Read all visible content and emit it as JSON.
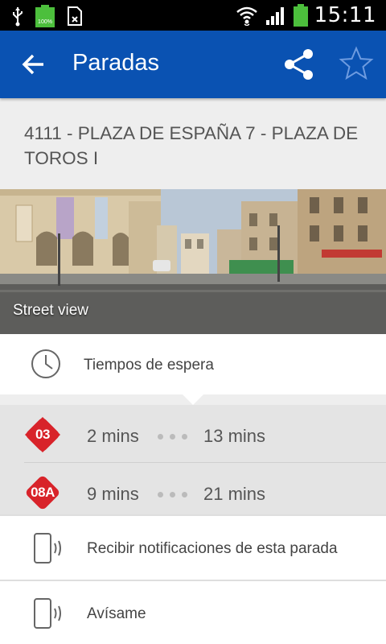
{
  "status_bar": {
    "time": "15:11",
    "battery_badge": "100%",
    "icons": [
      "usb-icon",
      "battery-full-icon",
      "sim-icon",
      "wifi-icon",
      "signal-icon",
      "battery-icon"
    ]
  },
  "app_bar": {
    "title": "Paradas",
    "icons": [
      "back-arrow-icon",
      "share-icon",
      "star-outline-icon"
    ]
  },
  "stop": {
    "title": "4111 - PLAZA DE ESPAÑA 7  - PLAZA DE TOROS I"
  },
  "street_view": {
    "label": "Street view"
  },
  "waiting": {
    "label": "Tiempos de espera",
    "icon": "clock-icon"
  },
  "lines": [
    {
      "line": "03",
      "color": "#d8232a",
      "first": "2 mins",
      "second": "13 mins"
    },
    {
      "line": "08A",
      "color": "#d8232a",
      "first": "9 mins",
      "second": "21 mins"
    }
  ],
  "actions": [
    {
      "label": "Recibir notificaciones de esta parada",
      "icon": "phone-vibrate-icon"
    },
    {
      "label": "Avísame",
      "icon": "phone-vibrate-icon"
    }
  ],
  "colors": {
    "app_bar": "#0a52b2",
    "status_bar": "#000000",
    "line_badge": "#d8232a"
  }
}
